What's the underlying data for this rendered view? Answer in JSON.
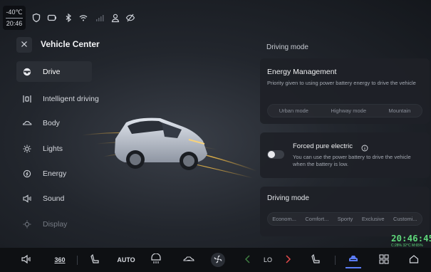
{
  "status": {
    "outside_temp": "-40℃",
    "time": "20:46",
    "icons": [
      "shield-icon",
      "battery-icon",
      "bluetooth-icon",
      "wifi-icon",
      "signal-icon",
      "user-icon",
      "eye-off-icon"
    ]
  },
  "sidebar": {
    "title": "Vehicle Center",
    "items": [
      {
        "label": "Drive",
        "icon": "steering-wheel-icon"
      },
      {
        "label": "Intelligent driving",
        "icon": "lane-icon"
      },
      {
        "label": "Body",
        "icon": "car-body-icon"
      },
      {
        "label": "Lights",
        "icon": "light-icon"
      },
      {
        "label": "Energy",
        "icon": "energy-icon"
      },
      {
        "label": "Sound",
        "icon": "speaker-icon"
      },
      {
        "label": "Display",
        "icon": "brightness-icon"
      }
    ]
  },
  "right": {
    "section_title": "Driving mode",
    "energy": {
      "title": "Energy Management",
      "desc": "Priority given to using power battery energy to drive the vehicle",
      "modes": [
        "Urban mode",
        "Highway mode",
        "Mountain"
      ]
    },
    "forced": {
      "title": "Forced pure electric",
      "desc": "You can use the power battery to drive the vehicle when the battery is low.",
      "enabled": false
    },
    "driving": {
      "title": "Driving mode",
      "modes": [
        "Econom...",
        "Comfort...",
        "Sporty",
        "Exclusive",
        "Customi..."
      ]
    }
  },
  "clock": {
    "time": "20:46:45",
    "sub": "C:28% 32°C M:65%"
  },
  "dock": {
    "b360": "360",
    "auto": "AUTO",
    "fan_level": "LO",
    "accent": "#5b7cf5",
    "clock_color": "#5fd87b"
  }
}
